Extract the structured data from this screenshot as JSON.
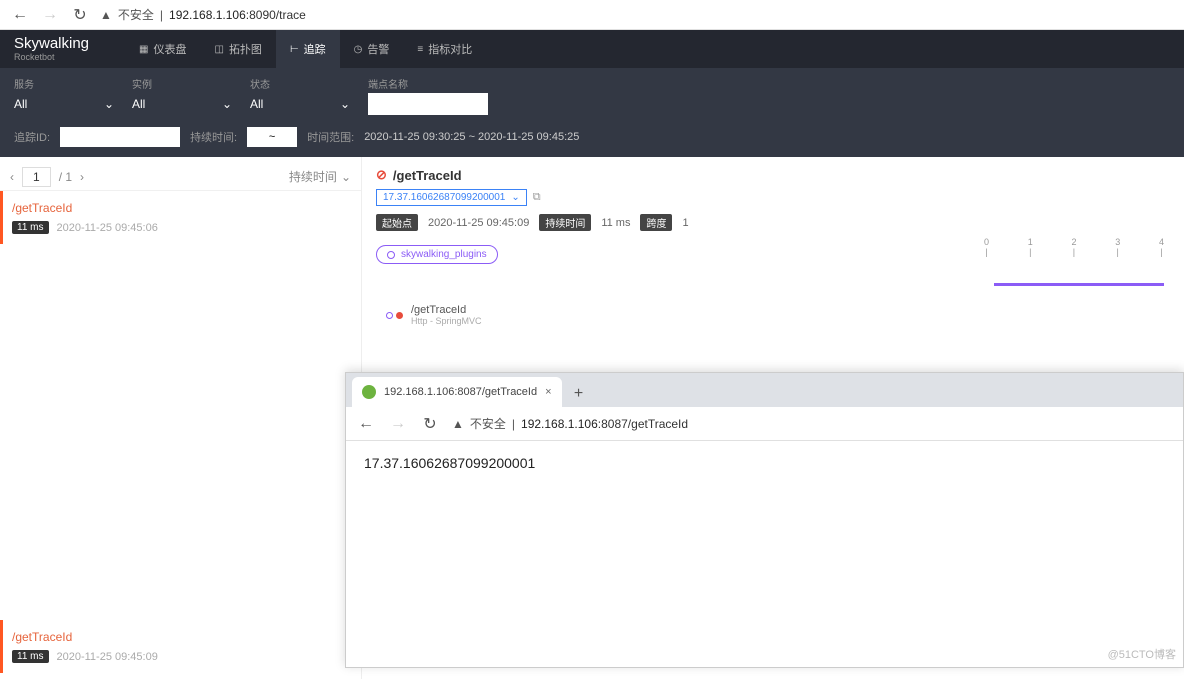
{
  "browser": {
    "insecure_label": "不安全",
    "url_host": "192.168.1.106",
    "url_port_path": ":8090/trace"
  },
  "header": {
    "logo": "Skywalking",
    "logo_sub": "Rocketbot",
    "nav": {
      "dashboard": "仪表盘",
      "topology": "拓扑图",
      "trace": "追踪",
      "alarm": "告警",
      "metrics": "指标对比"
    }
  },
  "filters": {
    "service_label": "服务",
    "service_value": "All",
    "instance_label": "实例",
    "instance_value": "All",
    "status_label": "状态",
    "status_value": "All",
    "endpoint_label": "端点名称",
    "endpoint_value": "",
    "trace_id_label": "追踪ID:",
    "trace_id_value": "",
    "duration_label": "持续时间:",
    "duration_value": "~",
    "time_range_label": "时间范围:",
    "time_range_value": "2020-11-25 09:30:25 ~ 2020-11-25 09:45:25"
  },
  "pager": {
    "current": "1",
    "total": "/ 1",
    "sort_label": "持续时间"
  },
  "traces": [
    {
      "title": "/getTraceId",
      "duration": "11 ms",
      "time": "2020-11-25 09:45:06"
    },
    {
      "title": "/getTraceId",
      "duration": "11 ms",
      "time": "2020-11-25 09:45:09"
    }
  ],
  "detail": {
    "title": "/getTraceId",
    "trace_id": "17.37.16062687099200001",
    "start_label": "起始点",
    "start_value": "2020-11-25 09:45:09",
    "duration_label": "持续时间",
    "duration_value": "11 ms",
    "span_label": "跨度",
    "span_value": "1",
    "tag": "skywalking_plugins",
    "ruler": [
      "0",
      "1",
      "2",
      "3",
      "4"
    ],
    "span": {
      "name": "/getTraceId",
      "sub": "Http - SpringMVC"
    }
  },
  "overlay": {
    "tab_title": "192.168.1.106:8087/getTraceId",
    "insecure_label": "不安全",
    "url_host": "192.168.1.106",
    "url_port_path": ":8087/getTraceId",
    "body": "17.37.16062687099200001"
  },
  "watermark": "@51CTO博客"
}
